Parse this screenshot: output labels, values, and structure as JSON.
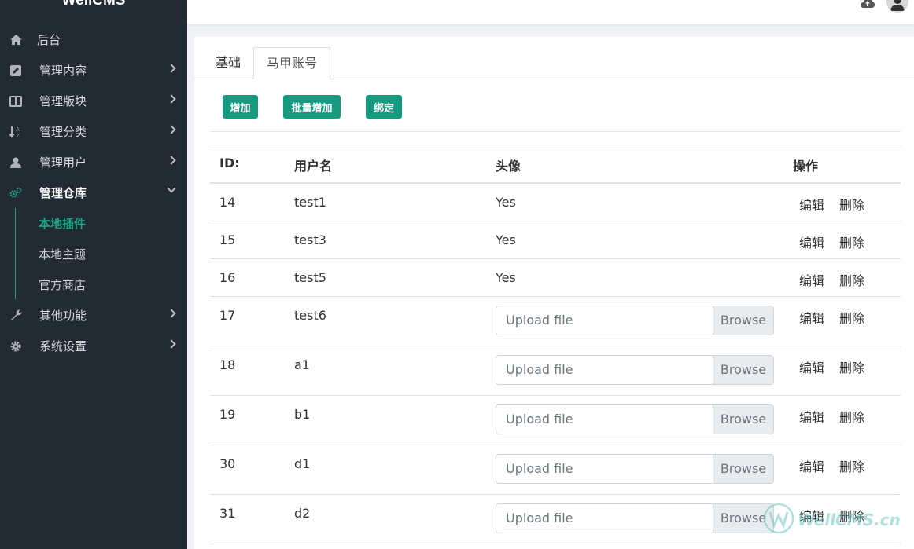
{
  "brand": "WellCMS",
  "sidebar": {
    "items": [
      {
        "label": "后台",
        "icon": "home-icon"
      },
      {
        "label": "管理内容",
        "icon": "edit-icon"
      },
      {
        "label": "管理版块",
        "icon": "columns-icon"
      },
      {
        "label": "管理分类",
        "icon": "sort-icon"
      },
      {
        "label": "管理用户",
        "icon": "user-icon"
      },
      {
        "label": "管理仓库",
        "icon": "cogs-icon"
      },
      {
        "label": "其他功能",
        "icon": "wrench-icon"
      },
      {
        "label": "系统设置",
        "icon": "gear-icon"
      }
    ],
    "subitems": [
      "本地插件",
      "本地主题",
      "官方商店"
    ]
  },
  "tabs": [
    "基础",
    "马甲账号"
  ],
  "buttons": {
    "add": "增加",
    "batch_add": "批量增加",
    "bind": "绑定"
  },
  "table": {
    "headers": [
      "ID:",
      "用户名",
      "头像",
      "操作"
    ],
    "rows": [
      {
        "id": "14",
        "name": "test1",
        "avatar": "Yes"
      },
      {
        "id": "15",
        "name": "test3",
        "avatar": "Yes"
      },
      {
        "id": "16",
        "name": "test5",
        "avatar": "Yes"
      },
      {
        "id": "17",
        "name": "test6",
        "avatar": ""
      },
      {
        "id": "18",
        "name": "a1",
        "avatar": ""
      },
      {
        "id": "19",
        "name": "b1",
        "avatar": ""
      },
      {
        "id": "30",
        "name": "d1",
        "avatar": ""
      },
      {
        "id": "31",
        "name": "d2",
        "avatar": ""
      }
    ],
    "edit": "编辑",
    "delete": "删除",
    "upload_placeholder": "Upload file",
    "browse": "Browse"
  },
  "watermark": "WellCMS.cn",
  "colors": {
    "accent": "#169b80",
    "sidebar_bg": "#222a33"
  }
}
